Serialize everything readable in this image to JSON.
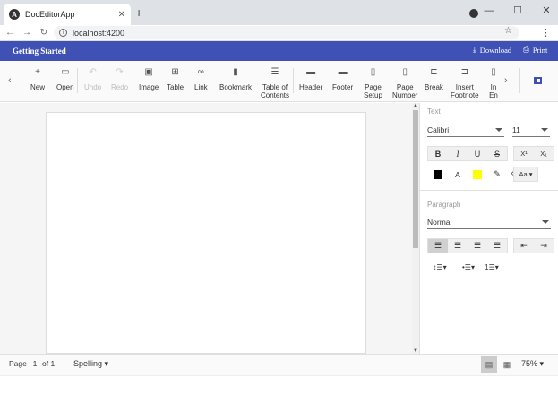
{
  "browser": {
    "tab_title": "DocEditorApp",
    "tab_favicon": "A",
    "url": "localhost:4200"
  },
  "appbar": {
    "title": "Getting Started",
    "download_label": "Download",
    "print_label": "Print"
  },
  "toolbar": {
    "items": [
      {
        "label": "New",
        "icon": "+"
      },
      {
        "label": "Open",
        "icon": "▭"
      },
      {
        "label": "Undo",
        "icon": "↶"
      },
      {
        "label": "Redo",
        "icon": "↷"
      },
      {
        "label": "Image",
        "icon": "▣"
      },
      {
        "label": "Table",
        "icon": "⊞"
      },
      {
        "label": "Link",
        "icon": "∞"
      },
      {
        "label": "Bookmark",
        "icon": "▮"
      },
      {
        "label": "Table of Contents",
        "line1": "Table of",
        "line2": "Contents",
        "icon": "☰"
      },
      {
        "label": "Header",
        "icon": "▬"
      },
      {
        "label": "Footer",
        "icon": "▬"
      },
      {
        "label": "Page Setup",
        "line1": "Page",
        "line2": "Setup",
        "icon": "▯"
      },
      {
        "label": "Page Number",
        "line1": "Page",
        "line2": "Number",
        "icon": "▯"
      },
      {
        "label": "Break",
        "icon": "⊏"
      },
      {
        "label": "Insert Footnote",
        "line1": "Insert",
        "line2": "Footnote",
        "icon": "⊐"
      },
      {
        "label": "In En",
        "line1": "In",
        "line2": "En",
        "icon": "▯"
      }
    ]
  },
  "pane": {
    "text_section": "Text",
    "font_family": "Calibri",
    "font_size": "11",
    "paragraph_section": "Paragraph",
    "style": "Normal",
    "change_case": "Aa",
    "font_color_label": "A",
    "superscript": "X¹",
    "subscript": "X₁"
  },
  "status": {
    "page_label": "Page",
    "page_value": "1",
    "of_label": "of 1",
    "spelling_label": "Spelling",
    "zoom": "75%"
  },
  "colors": {
    "accent": "#3f51b5",
    "highlight": "#ffff00",
    "font_color": "#000000"
  }
}
